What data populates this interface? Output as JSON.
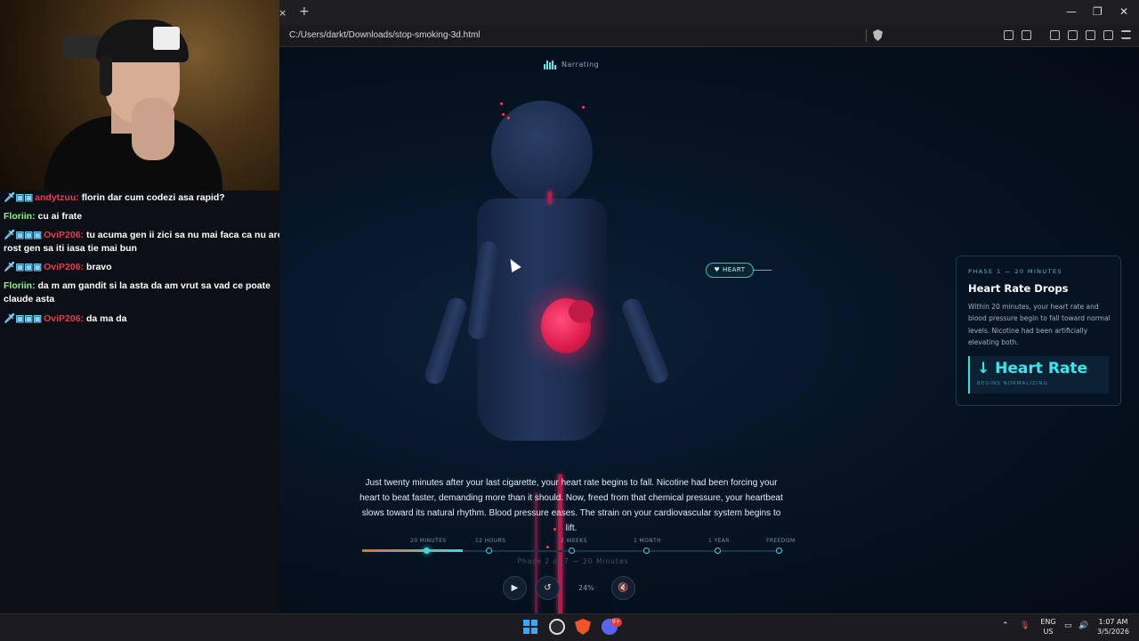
{
  "browser": {
    "address": "C:/Users/darkt/Downloads/stop-smoking-3d.html",
    "tab_close": "×",
    "new_tab": "+",
    "minimize": "—",
    "maximize": "❐",
    "close": "✕"
  },
  "chat": {
    "messages": [
      {
        "user": "andytzuu",
        "text": "florin dar cum codezi asa rapid?"
      },
      {
        "user": "Floriin",
        "text": "cu ai frate"
      },
      {
        "user": "OviP206",
        "text": "tu acuma gen ii zici sa nu mai faca ca nu are rost gen sa iti iasa tie mai bun"
      },
      {
        "user": "OviP206",
        "text": "bravo"
      },
      {
        "user": "Floriin",
        "text": "da m am gandit si la asta da am vrut sa vad ce poate claude asta"
      },
      {
        "user": "OviP206",
        "text": "da ma da"
      }
    ]
  },
  "stage": {
    "narrating": "Narrating",
    "heart_label": "♥ HEART",
    "narration": "Just twenty minutes after your last cigarette, your heart rate begins to fall. Nicotine had been forcing your heart to beat faster, demanding more than it should. Now, freed from that chemical pressure, your heartbeat slows toward its natural rhythm. Blood pressure eases. The strain on your cardiovascular system begins to lift."
  },
  "card": {
    "phase": "PHASE 1 — 20 MINUTES",
    "title": "Heart Rate Drops",
    "body": "Within 20 minutes, your heart rate and blood pressure begin to fall toward normal levels. Nicotine had been artificially elevating both.",
    "metric_value": "↓ Heart Rate",
    "metric_sub": "BEGINS NORMALIZING"
  },
  "timeline": {
    "labels": [
      "20 MINUTES",
      "12 HOURS",
      "2 WEEKS",
      "1 MONTH",
      "1 YEAR",
      "FREEDOM"
    ],
    "phase_text": "Phase 2 of 7 — 20 Minutes",
    "progress": 0.24
  },
  "controls": {
    "play": "▶",
    "restart": "↺",
    "percent": "24%",
    "mute": "🔇"
  },
  "taskbar": {
    "lang": "ENG",
    "region": "US",
    "time": "1:07 AM",
    "date": "3/5/2026",
    "discord_badge": "9+"
  },
  "colors": {
    "accent": "#3fd7d7",
    "heart": "#e01f4f",
    "background": "#04101c"
  }
}
